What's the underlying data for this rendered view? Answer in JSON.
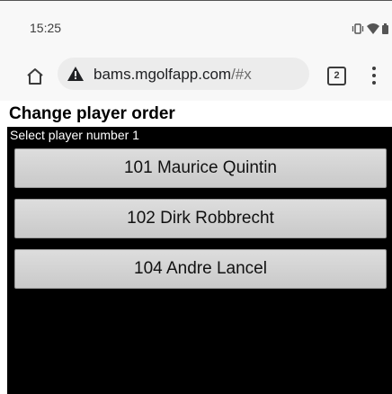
{
  "status_bar": {
    "time": "15:25",
    "icons": [
      "vibrate-icon",
      "wifi-icon",
      "battery-icon"
    ]
  },
  "browser": {
    "url_host": "bams.mgolfapp.com",
    "url_hash": "/#x",
    "tab_count": "2",
    "security_icon": "warning-icon"
  },
  "page": {
    "title": "Change player order",
    "prompt": "Select player number 1",
    "players": [
      {
        "label": "101 Maurice Quintin"
      },
      {
        "label": "102 Dirk Robbrecht"
      },
      {
        "label": "104 Andre Lancel"
      }
    ]
  }
}
